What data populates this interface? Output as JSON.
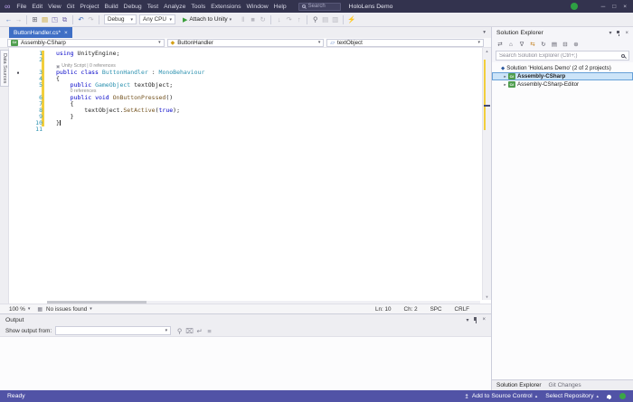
{
  "colors": {
    "titlebar_bg": "#33334E",
    "toolbar_bg": "#EEEEF2",
    "active_tab_bg": "#3F6FC5",
    "statusbar_bg": "#5153A6",
    "modified_yellow": "#F2CE3C",
    "keyword_blue": "#0000C8",
    "type_teal": "#2B91AF",
    "method_brown": "#74531F",
    "selection_bg": "#CCE4F8",
    "run_green": "#3A9E3A"
  },
  "titlebar": {
    "menus": [
      "File",
      "Edit",
      "View",
      "Git",
      "Project",
      "Build",
      "Debug",
      "Test",
      "Analyze",
      "Tools",
      "Extensions",
      "Window",
      "Help"
    ],
    "search_placeholder": "Search",
    "solution_title": "HoloLens Demo",
    "window_controls": {
      "minimize": "─",
      "maximize": "□",
      "close": "×"
    }
  },
  "toolbar": {
    "debug_target": "Debug",
    "platform": "Any CPU",
    "attach_label": "Attach to Unity",
    "icons_left": [
      {
        "name": "back-icon",
        "g": "←",
        "c": "#3E6DBF"
      },
      {
        "name": "forward-icon",
        "g": "→",
        "c": "#A8A8B2"
      },
      {
        "name": "sep"
      },
      {
        "name": "new-project-icon",
        "g": "⊞",
        "c": "#6A6A75"
      },
      {
        "name": "open-file-icon",
        "g": "▤",
        "c": "#C9A227"
      },
      {
        "name": "save-icon",
        "g": "◳",
        "c": "#7A6FB0"
      },
      {
        "name": "save-all-icon",
        "g": "⧉",
        "c": "#7A6FB0"
      },
      {
        "name": "sep"
      },
      {
        "name": "undo-icon",
        "g": "↶",
        "c": "#3E6DBF"
      },
      {
        "name": "redo-icon",
        "g": "↷",
        "c": "#B8B8C0"
      },
      {
        "name": "sep"
      }
    ],
    "icons_right": [
      {
        "name": "pause-icon",
        "g": "‖",
        "c": "#B8B8C0"
      },
      {
        "name": "stop-icon",
        "g": "■",
        "c": "#B8B8C0"
      },
      {
        "name": "restart-icon",
        "g": "↻",
        "c": "#B8B8C0"
      },
      {
        "name": "sep"
      },
      {
        "name": "step-into-icon",
        "g": "↓",
        "c": "#B8B8C0"
      },
      {
        "name": "step-over-icon",
        "g": "↷",
        "c": "#B8B8C0"
      },
      {
        "name": "step-out-icon",
        "g": "↑",
        "c": "#B8B8C0"
      },
      {
        "name": "sep"
      },
      {
        "name": "find-icon",
        "g": "⚲",
        "c": "#6A6A75"
      },
      {
        "name": "comment-icon",
        "g": "▤",
        "c": "#B8B8C0"
      },
      {
        "name": "bookmark-icon",
        "g": "▥",
        "c": "#B8B8C0"
      },
      {
        "name": "sep"
      },
      {
        "name": "live-share-icon",
        "g": "⚡",
        "c": "#5A5A66"
      }
    ]
  },
  "tabs": [
    {
      "label": "ButtonHandler.cs*"
    }
  ],
  "navbar": {
    "project": "Assembly-CSharp",
    "project_badge": "C#",
    "type": "ButtonHandler",
    "member": "textObject"
  },
  "left_tab": "Data Sources",
  "editor": {
    "lines": [
      {
        "n": "1",
        "seg": [
          [
            "k",
            "using"
          ],
          [
            "p",
            " UnityEngine;"
          ]
        ]
      },
      {
        "n": "2",
        "seg": []
      },
      {
        "codelens": "Unity Script | 0 references",
        "icon": true
      },
      {
        "n": "3",
        "gutter": true,
        "seg": [
          [
            "k",
            "public"
          ],
          [
            "p",
            " "
          ],
          [
            "k",
            "class"
          ],
          [
            "p",
            " "
          ],
          [
            "t",
            "ButtonHandler"
          ],
          [
            "p",
            " : "
          ],
          [
            "t",
            "MonoBehaviour"
          ]
        ]
      },
      {
        "n": "4",
        "seg": [
          [
            "p",
            "{"
          ]
        ]
      },
      {
        "n": "5",
        "seg": [
          [
            "p",
            "    "
          ],
          [
            "k",
            "public"
          ],
          [
            "p",
            " "
          ],
          [
            "t",
            "GameObject"
          ],
          [
            "p",
            " textObject;"
          ]
        ]
      },
      {
        "codelens": "0 references",
        "indent": 4
      },
      {
        "n": "6",
        "seg": [
          [
            "k",
            "    public"
          ],
          [
            "p",
            " "
          ],
          [
            "k",
            "void"
          ],
          [
            "p",
            " "
          ],
          [
            "m",
            "OnButtonPressed"
          ],
          [
            "p",
            "()"
          ]
        ]
      },
      {
        "n": "7",
        "seg": [
          [
            "p",
            "    {"
          ]
        ]
      },
      {
        "n": "8",
        "seg": [
          [
            "p",
            "        textObject."
          ],
          [
            "m",
            "SetActive"
          ],
          [
            "p",
            "("
          ],
          [
            "k",
            "true"
          ],
          [
            "p",
            ");"
          ]
        ]
      },
      {
        "n": "9",
        "seg": [
          [
            "p",
            "    }"
          ]
        ]
      },
      {
        "n": "10",
        "caret": true,
        "seg": [
          [
            "p",
            "}"
          ]
        ]
      },
      {
        "n": "11",
        "seg": []
      }
    ],
    "status": {
      "zoom": "100 %",
      "health": "No issues found",
      "ln": "Ln: 10",
      "col": "Ch: 2",
      "spc": "SPC",
      "eol": "CRLF"
    }
  },
  "output": {
    "title": "Output",
    "show_from_label": "Show output from:",
    "toolbar_icons": [
      {
        "name": "find-message-icon",
        "g": "⚲",
        "c": "#8A8A96"
      },
      {
        "name": "clear-all-icon",
        "g": "⌧",
        "c": "#8A8A96"
      },
      {
        "name": "word-wrap-icon",
        "g": "↵",
        "c": "#8A8A96"
      },
      {
        "name": "expand-all-icon",
        "g": "≡",
        "c": "#8A8A96"
      }
    ]
  },
  "solution_explorer": {
    "title": "Solution Explorer",
    "search_placeholder": "Search Solution Explorer (Ctrl+;)",
    "toolbar_icons": [
      {
        "name": "switch-views-icon",
        "g": "⇄",
        "c": "#5A5A66"
      },
      {
        "name": "home-icon",
        "g": "⌂",
        "c": "#5A5A66"
      },
      {
        "name": "filter-icon",
        "g": "∇",
        "c": "#5A5A66"
      },
      {
        "name": "sync-active-document-icon",
        "g": "⇆",
        "c": "#C27D1A"
      },
      {
        "name": "refresh-icon",
        "g": "↻",
        "c": "#5A5A66"
      },
      {
        "name": "show-all-files-icon",
        "g": "▤",
        "c": "#5A5A66"
      },
      {
        "name": "collapse-all-icon",
        "g": "⊟",
        "c": "#5A5A66"
      },
      {
        "name": "properties-icon",
        "g": "⊛",
        "c": "#5A5A66"
      }
    ],
    "items": [
      {
        "name": "solution-node",
        "label": "Solution 'HoloLens Demo' (2 of 2 projects)",
        "icon": "solution",
        "level": 0
      },
      {
        "name": "project-assembly-csharp",
        "label": "Assembly-CSharp",
        "icon": "csproj",
        "level": 1,
        "chevron": true,
        "selected": true,
        "bold": true
      },
      {
        "name": "project-assembly-csharp-editor",
        "label": "Assembly-CSharp-Editor",
        "icon": "csproj",
        "level": 1,
        "chevron": true
      }
    ],
    "project_badge": "C#",
    "bottom_tabs": [
      "Solution Explorer",
      "Git Changes"
    ]
  },
  "status_bar": {
    "ready": "Ready",
    "add_source": "Add to Source Control",
    "select_repo": "Select Repository"
  }
}
